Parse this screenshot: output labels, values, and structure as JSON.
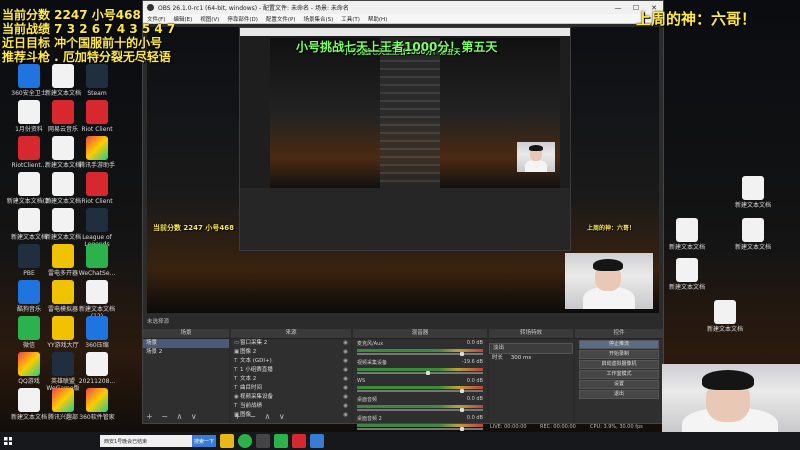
{
  "overlay": {
    "score_line": "当前分数 2247   小号468",
    "record_line": "当前战绩 7 3 2 6 7 4 3 5 4 7",
    "goal_line": "近日目标 冲个国服前十的小号",
    "rec_line": "推荐斗枪 . 厄加特分裂无尽轻语",
    "challenge_line": "小号挑战七天上王者1000分！第五天",
    "gift_line": "上周的神：六哥！",
    "inner_score": "当前分数 2247  小号468",
    "inner_gift": "上周的神：六哥！",
    "inner_challenge": "小号挑战七天上王者1000分！第五天",
    "colors": {
      "yellow": "#ffe94a",
      "green": "#7dff66"
    }
  },
  "desktop_icons": [
    {
      "label": "360安全卫士",
      "icon": "shield-icon"
    },
    {
      "label": "新建文本文档",
      "icon": "doc-icon"
    },
    {
      "label": "Steam",
      "icon": "steam-icon"
    },
    {
      "label": "1月份资料",
      "icon": "doc-icon"
    },
    {
      "label": "网易云音乐",
      "icon": "music-icon"
    },
    {
      "label": "Riot Client",
      "icon": "riot-icon"
    },
    {
      "label": "RiotClient...",
      "icon": "riot-icon"
    },
    {
      "label": "新建文本文档",
      "icon": "doc-icon"
    },
    {
      "label": "腾讯手游助手",
      "icon": "app-icon"
    },
    {
      "label": "新建文本文档(2)",
      "icon": "doc-icon"
    },
    {
      "label": "新建文本文档",
      "icon": "doc-icon"
    },
    {
      "label": "Riot Client",
      "icon": "riot-icon"
    },
    {
      "label": "新建文本文档",
      "icon": "doc-icon"
    },
    {
      "label": "新建文本文档",
      "icon": "doc-icon"
    },
    {
      "label": "League of Legends",
      "icon": "lol-icon"
    },
    {
      "label": "PBE",
      "icon": "pbe-icon"
    },
    {
      "label": "雷电多开器",
      "icon": "ld-icon"
    },
    {
      "label": "WeChatSe...",
      "icon": "wechat-icon"
    },
    {
      "label": "酷狗音乐",
      "icon": "kugou-icon"
    },
    {
      "label": "雷电模拟器",
      "icon": "ld-icon"
    },
    {
      "label": "新建文本文档(12)",
      "icon": "doc-icon"
    },
    {
      "label": "微信",
      "icon": "wechat-icon"
    },
    {
      "label": "YY游戏大厅",
      "icon": "yy-icon"
    },
    {
      "label": "360压缩",
      "icon": "zip-icon"
    },
    {
      "label": "QQ游戏",
      "icon": "qq-icon"
    },
    {
      "label": "英雄联盟WeGame版",
      "icon": "lol-icon"
    },
    {
      "label": "20211208...",
      "icon": "doc-icon"
    },
    {
      "label": "新建文本文档",
      "icon": "doc-icon"
    },
    {
      "label": "腾讯兴趣部",
      "icon": "app-icon"
    },
    {
      "label": "360软件管家",
      "icon": "app-icon"
    }
  ],
  "right_icons": [
    {
      "label": "新建文本文档"
    },
    {
      "label": "新建文本文档"
    },
    {
      "label": "新建文本文档"
    },
    {
      "label": "新建文本文档"
    },
    {
      "label": "新建文本文档"
    }
  ],
  "obs": {
    "title": "OBS 26.1.0-rc1 (64-bit, windows) - 配置文件: 未命名 - 场景: 未命名",
    "menu": [
      "文件(F)",
      "编辑(E)",
      "视图(V)",
      "停靠部件(D)",
      "配置文件(P)",
      "场景集合(S)",
      "工具(T)",
      "帮助(H)"
    ],
    "window_controls": {
      "min": "—",
      "max": "☐",
      "close": "✕"
    },
    "no_source": "未选择源",
    "docks": {
      "scenes": {
        "title": "场景",
        "items": [
          "场景",
          "场景 2"
        ]
      },
      "sources": {
        "title": "来源",
        "items": [
          {
            "label": "窗口采集 2",
            "icon": "window-icon"
          },
          {
            "label": "图像 2",
            "icon": "image-icon"
          },
          {
            "label": "文本 (GDI+)",
            "icon": "text-icon"
          },
          {
            "label": "1 小组赛直播",
            "icon": "text-icon"
          },
          {
            "label": "文本 2",
            "icon": "text-icon"
          },
          {
            "label": "曲目时间",
            "icon": "text-icon"
          },
          {
            "label": "视频采集设备",
            "icon": "camera-icon"
          },
          {
            "label": "当前战绩",
            "icon": "text-icon"
          },
          {
            "label": "图像",
            "icon": "image-icon"
          }
        ]
      },
      "mixer": {
        "title": "混音器",
        "channels": [
          {
            "name": "麦克风/Aux",
            "db": "0.0 dB",
            "level": 0.82
          },
          {
            "name": "视频采集设备",
            "db": "-19.6 dB",
            "level": 0.55
          },
          {
            "name": "WS",
            "db": "0.0 dB",
            "level": 0.82
          },
          {
            "name": "桌面音频",
            "db": "0.0 dB",
            "level": 0.82
          },
          {
            "name": "桌面音频 2",
            "db": "0.0 dB",
            "level": 0.82
          }
        ]
      },
      "transitions": {
        "title": "转场特效",
        "type": "淡出",
        "duration_label": "时长",
        "duration": "300 ms"
      },
      "controls": {
        "title": "控件",
        "buttons": [
          "停止推流",
          "开始录制",
          "启动虚拟摄像机",
          "工作室模式",
          "设置",
          "退出"
        ]
      }
    },
    "status": {
      "live": "LIVE: 00:00:00",
      "rec": "REC: 00:00:00",
      "cpu": "CPU: 3.9%, 30.00 fps"
    },
    "tool_buttons": "+ − ∧ ∨"
  },
  "taskbar": {
    "search_text": "西安1号晚会已结束",
    "search_button": "搜索一下"
  }
}
